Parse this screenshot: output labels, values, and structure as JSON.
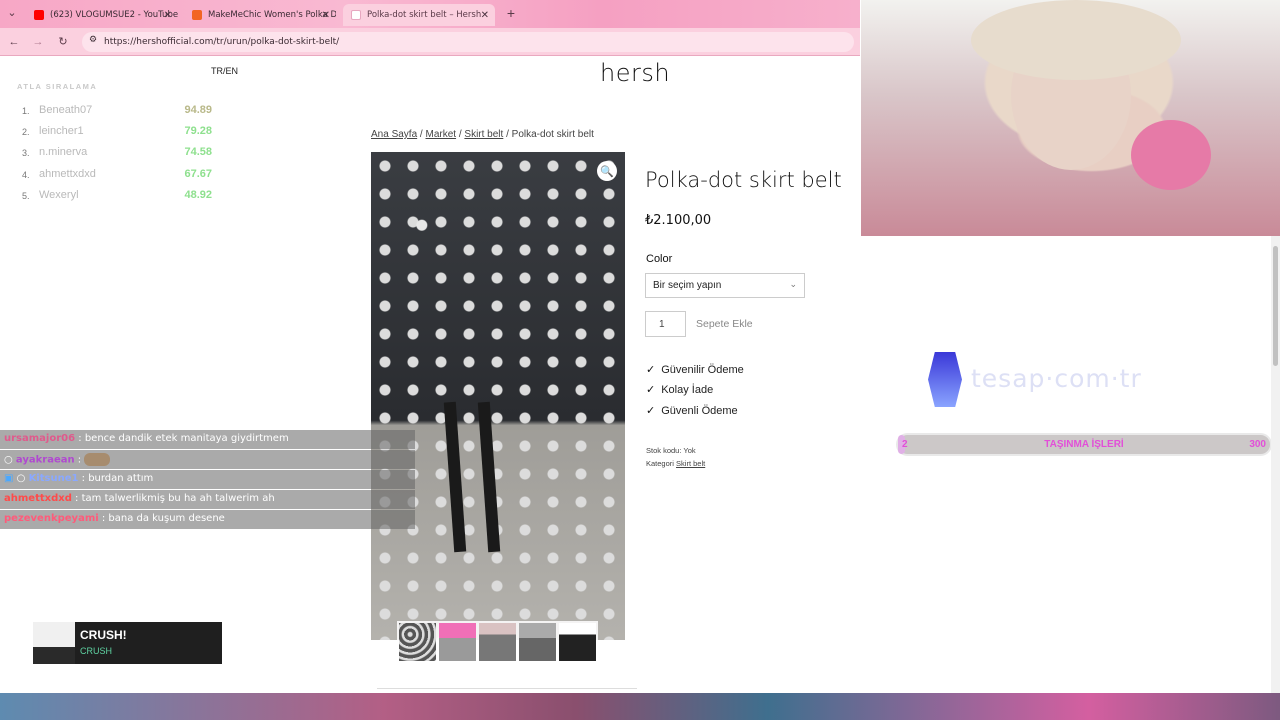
{
  "browser": {
    "tabs": [
      {
        "label": "(623) VLOGUMSUE2 - YouTube",
        "fav_color": "#ff0000"
      },
      {
        "label": "MakeMeChic Women's Polka D",
        "fav_color": "#f26522"
      },
      {
        "label": "Polka-dot skirt belt – Hersh",
        "fav_color": "#f5c2d6"
      }
    ],
    "new_tab_icon": "+",
    "url": "https://hershofficial.com/tr/urun/polka-dot-skirt-belt/"
  },
  "site": {
    "lang_switch": "TR/EN",
    "logo": "hersh",
    "breadcrumb": {
      "home": "Ana Sayfa",
      "sep": " / ",
      "market": "Market",
      "category": "Skirt belt",
      "current": "Polka-dot skirt belt"
    }
  },
  "product": {
    "title": "Polka-dot skirt belt",
    "price": "₺2.100,00",
    "color_label": "Color",
    "color_select": "Bir seçim yapın",
    "quantity": "1",
    "add_to_cart": "Sepete Ekle",
    "features": [
      "Güvenilir Ödeme",
      "Kolay İade",
      "Güvenli Ödeme"
    ],
    "sku": "Stok kodu: Yok",
    "category_label": "Kategori",
    "category_link": "Skirt belt",
    "thumbnail_count": 5
  },
  "overlay": {
    "leaderboard": {
      "title": "ATLA SIRALAMA",
      "rows": [
        {
          "rank": "1.",
          "name": "Beneath07",
          "score": "94.89",
          "color": "#b9b98a"
        },
        {
          "rank": "2.",
          "name": "leincher1",
          "score": "79.28",
          "color": "#8ee08e"
        },
        {
          "rank": "3.",
          "name": "n.minerva",
          "score": "74.58",
          "color": "#8ee08e"
        },
        {
          "rank": "4.",
          "name": "ahmettxdxd",
          "score": "67.67",
          "color": "#8ee08e"
        },
        {
          "rank": "5.",
          "name": "Wexeryl",
          "score": "48.92",
          "color": "#8ee08e"
        }
      ]
    },
    "chat": [
      {
        "user": "ursamajor06",
        "user_color": "#e05a8c",
        "message": ": bence dandik etek manitaya giydirtmem"
      },
      {
        "user": "ayakraean",
        "user_color": "#b04ad0",
        "message": ":"
      },
      {
        "user": "Kitsune1",
        "user_color": "#8aa8ff",
        "message": ": burdan attım"
      },
      {
        "user": "ahmettxdxd",
        "user_color": "#ff4a4a",
        "message": ": tam talwerlikmiş bu ha ah talwerim ah"
      },
      {
        "user": "pezevenkpeyami",
        "user_color": "#ff5a7a",
        "message": ": bana da kuşum desene"
      }
    ],
    "music": {
      "song": "CRUSH!",
      "artist": "CRUSH"
    },
    "sponsor": "tesap·com·tr",
    "goal": {
      "start": "2",
      "label": "TAŞINMA İŞLERİ",
      "end": "300",
      "progress": 0.007
    }
  }
}
